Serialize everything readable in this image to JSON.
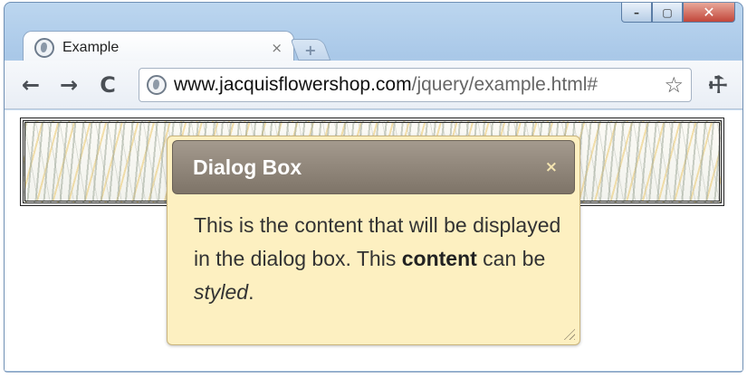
{
  "window": {
    "controls": [
      "minimize",
      "maximize",
      "close"
    ]
  },
  "tab": {
    "title": "Example",
    "close": "×",
    "new_tab": "+"
  },
  "toolbar": {
    "back": "←",
    "forward": "→",
    "reload": "C",
    "url_domain": "www.jacquisflowershop.com",
    "url_path": "/jquery/example.html#",
    "bookmark": "☆",
    "wrench": "🔧"
  },
  "dialog": {
    "title": "Dialog Box",
    "close": "×",
    "body_text_1": "This is the content that will be displayed in the dialog box. This ",
    "body_bold": "content",
    "body_text_2": " can be ",
    "body_italic": "styled",
    "body_text_3": "."
  },
  "colors": {
    "dialog_background": "#fdf0c1",
    "dialog_titlebar": "#8a8074",
    "chrome_frame": "#a9c8e8"
  }
}
